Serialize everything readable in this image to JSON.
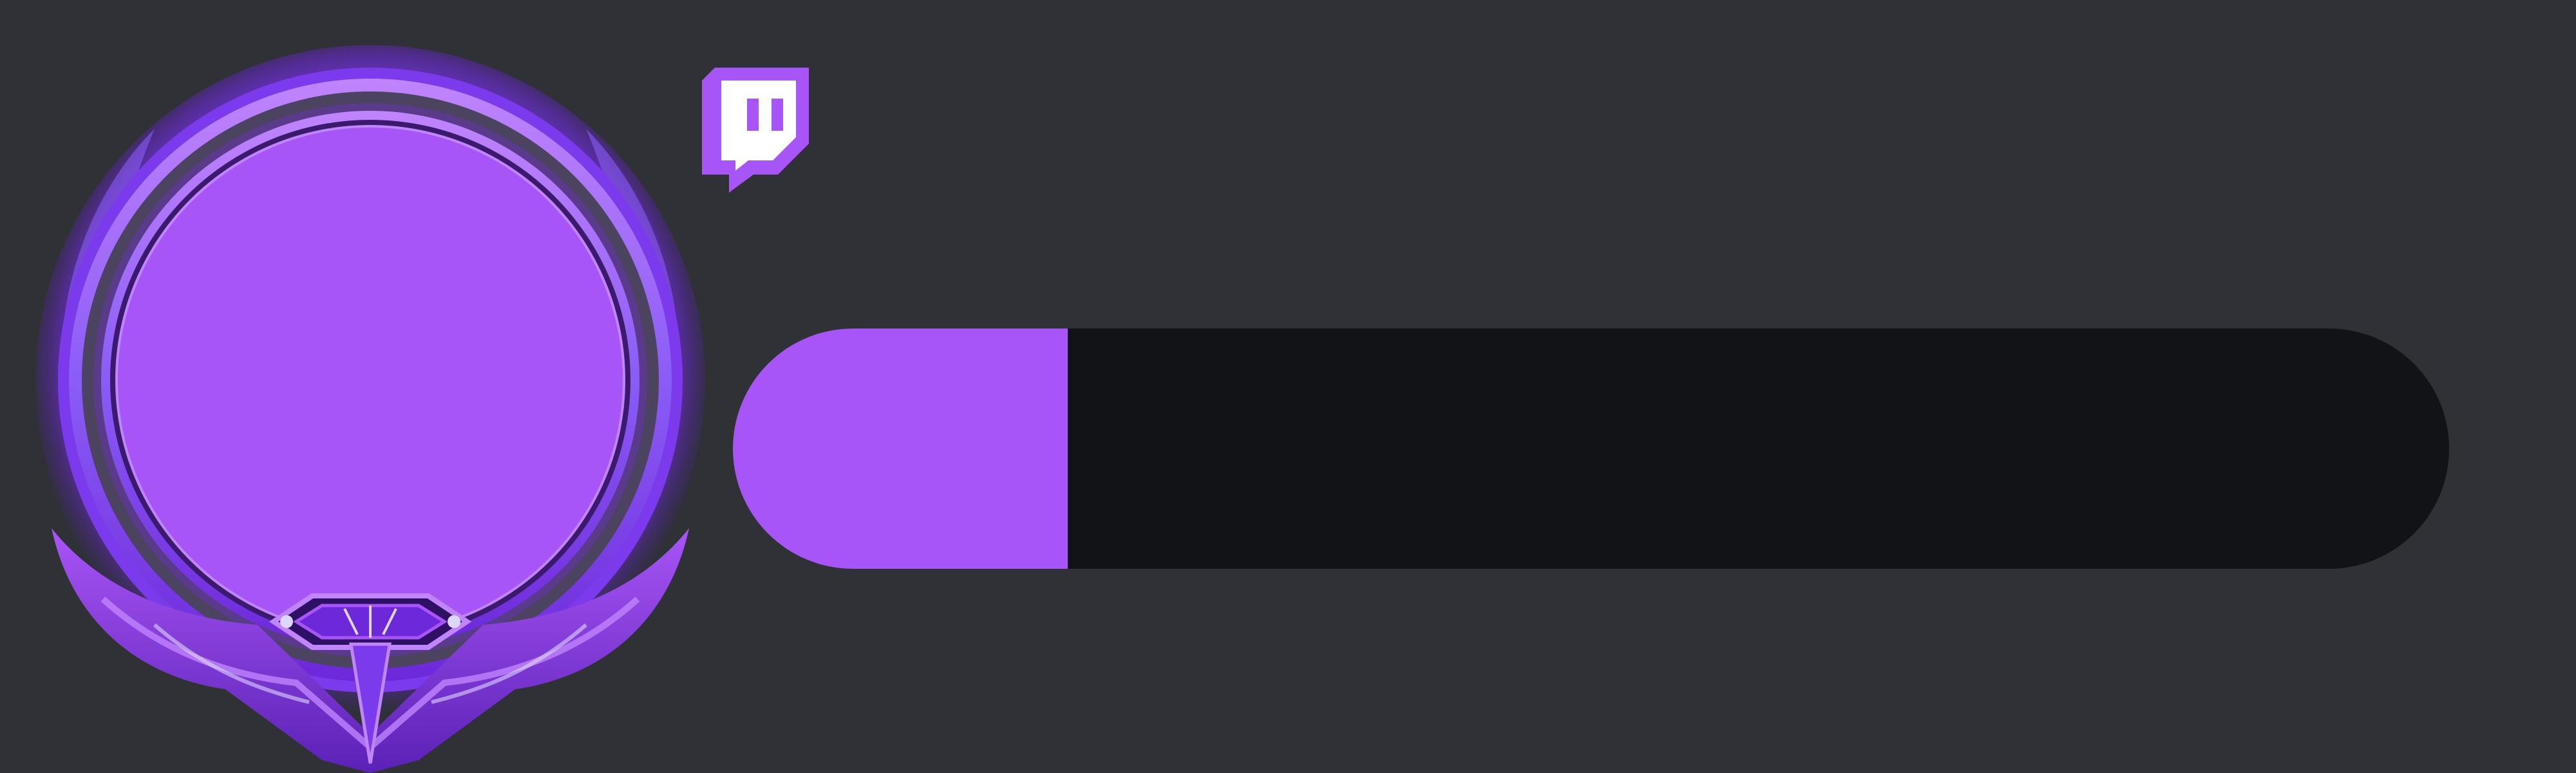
{
  "colors": {
    "background": "#2f3136",
    "brand_purple": "#a855f7",
    "purple_deep": "#6d28d9",
    "purple_light": "#c084fc",
    "track": "#121316"
  },
  "profile_frame": {
    "icon": "ornate-avatar-frame-icon",
    "avatar_placeholder_color": "#a855f7"
  },
  "platform_badge": {
    "icon": "twitch-logo-icon",
    "color": "#a855f7"
  },
  "progress": {
    "fraction": 0.195
  }
}
